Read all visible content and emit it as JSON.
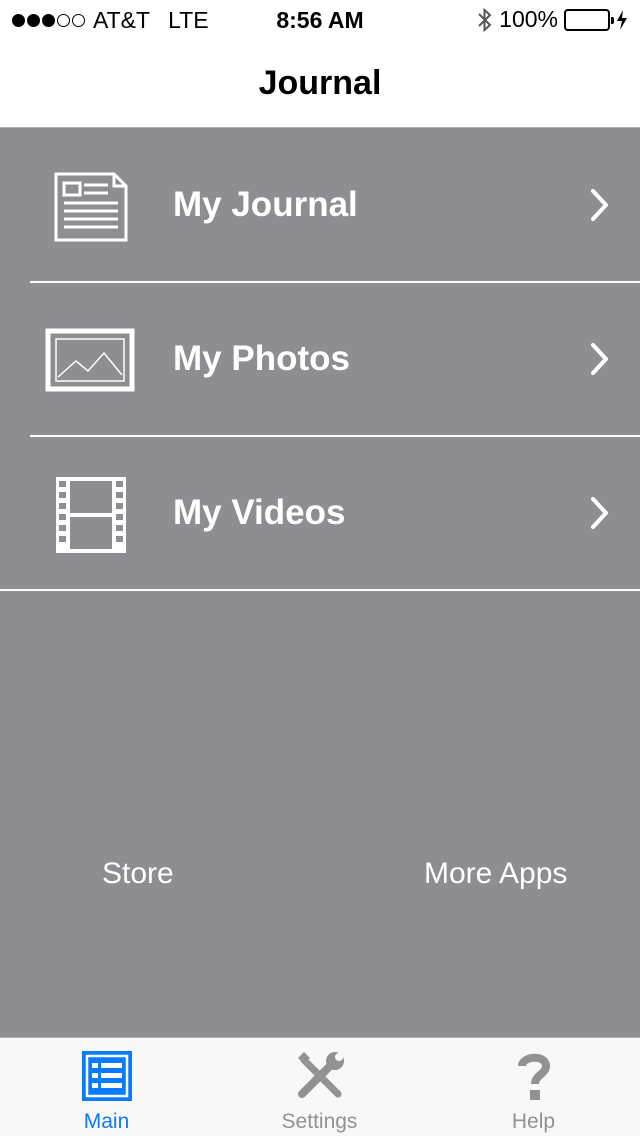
{
  "status_bar": {
    "signal_dots": "●●●○○",
    "carrier": "AT&T",
    "network": "LTE",
    "time": "8:56 AM",
    "battery": "100%",
    "battery_level": 1.0
  },
  "nav": {
    "title": "Journal"
  },
  "menu": [
    {
      "label": "My Journal",
      "icon": "journal-icon"
    },
    {
      "label": "My Photos",
      "icon": "photo-icon"
    },
    {
      "label": "My Videos",
      "icon": "film-icon"
    }
  ],
  "links": {
    "store": "Store",
    "more_apps": "More Apps"
  },
  "tabs": [
    {
      "label": "Main",
      "icon": "list-icon",
      "active": true
    },
    {
      "label": "Settings",
      "icon": "tools-icon",
      "active": false
    },
    {
      "label": "Help",
      "icon": "question-icon",
      "active": false
    }
  ],
  "colors": {
    "background": "#8e8d92",
    "accent": "#0a7aff",
    "battery": "#4cd964",
    "tab_inactive": "#929292"
  }
}
